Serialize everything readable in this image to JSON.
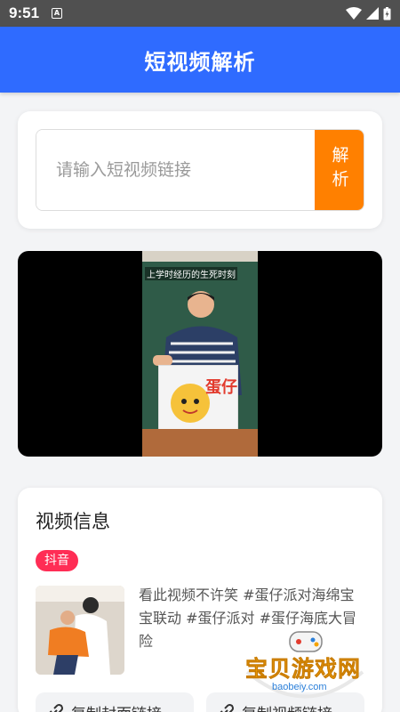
{
  "status_bar": {
    "time": "9:51",
    "notification_badge": "A"
  },
  "app_bar": {
    "title": "短视频解析"
  },
  "input_card": {
    "placeholder": "请输入短视频链接",
    "value": "",
    "parse_button": "解析"
  },
  "video_player": {
    "overlay_caption": "上学时经历的生死时刻",
    "box_text": "蛋仔"
  },
  "video_info": {
    "title": "视频信息",
    "platform_tag": "抖音",
    "description": "看此视频不许笑 #蛋仔派对海绵宝宝联动 #蛋仔派对 #蛋仔海底大冒险",
    "copy_cover_button": "复制封面链接",
    "copy_video_button": "复制视频链接"
  },
  "watermark": {
    "text": "宝贝游戏网",
    "url": "baobeiy.com"
  },
  "colors": {
    "primary": "#2f6bff",
    "accent": "#ff8000",
    "tag": "#ff2d55",
    "background": "#f3f4f6"
  }
}
